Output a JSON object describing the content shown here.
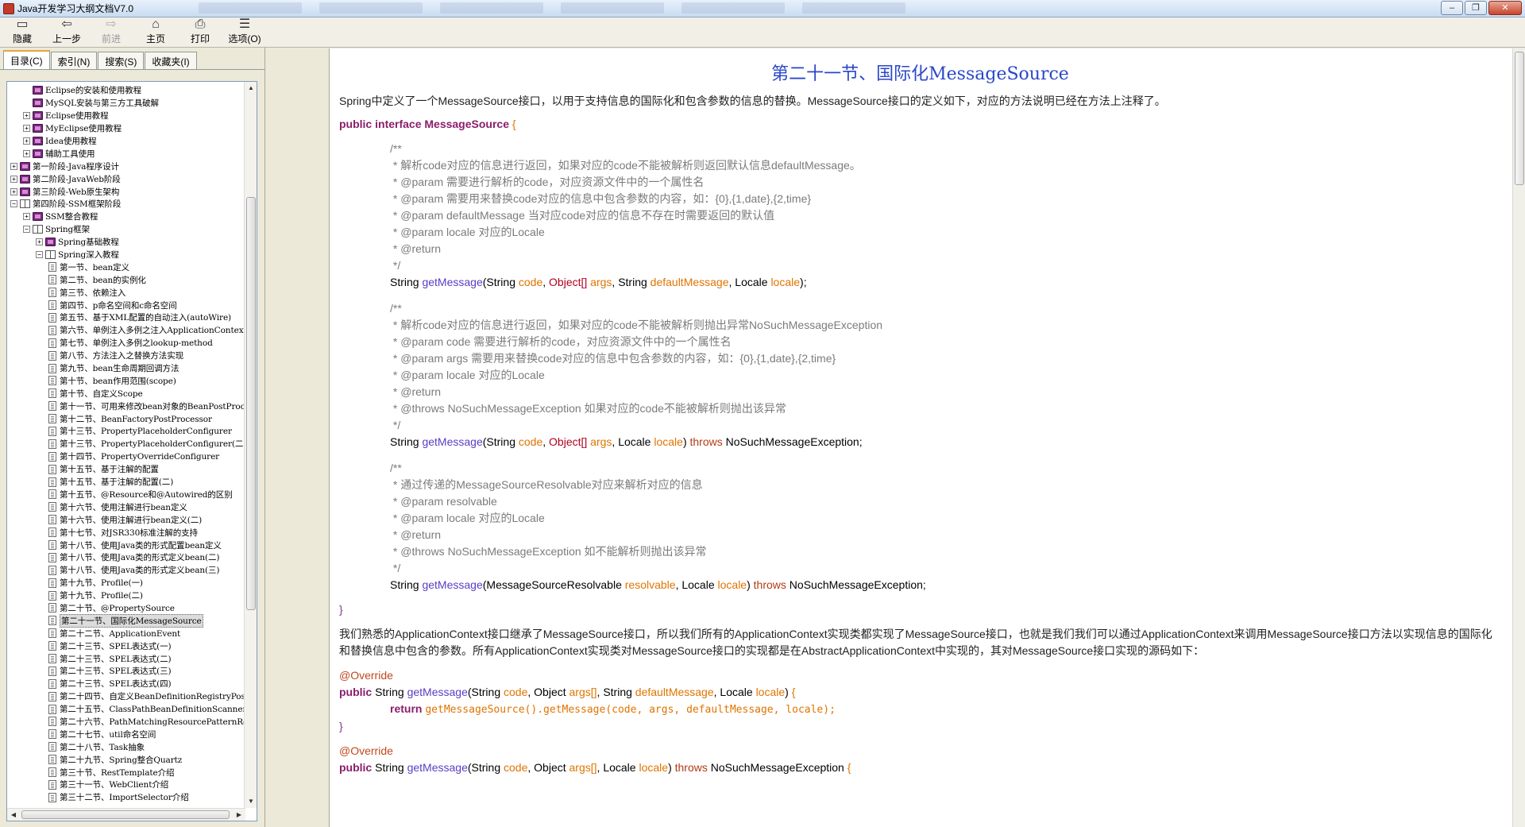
{
  "window": {
    "title": "Java开发学习大纲文档V7.0",
    "buttons": [
      "‒",
      "❐",
      "✕"
    ]
  },
  "toolbar": [
    {
      "label": "隐藏",
      "icon": "hide-icon",
      "disabled": false
    },
    {
      "label": "上一步",
      "icon": "back-arrow-icon",
      "disabled": false
    },
    {
      "label": "前进",
      "icon": "forward-arrow-icon",
      "disabled": true
    },
    {
      "label": "主页",
      "icon": "home-icon",
      "disabled": false
    },
    {
      "label": "打印",
      "icon": "print-icon",
      "disabled": false
    },
    {
      "label": "选项(O)",
      "icon": "options-icon",
      "disabled": false
    }
  ],
  "nav_tabs": [
    "目录(C)",
    "索引(N)",
    "搜索(S)",
    "收藏夹(I)"
  ],
  "tree": [
    {
      "indent": 1,
      "exp": "",
      "icon": "closed",
      "label": "Eclipse的安装和使用教程"
    },
    {
      "indent": 1,
      "exp": "",
      "icon": "closed",
      "label": "MySQL安装与第三方工具破解"
    },
    {
      "indent": 1,
      "exp": "+",
      "icon": "closed",
      "label": "Eclipse使用教程"
    },
    {
      "indent": 1,
      "exp": "+",
      "icon": "closed",
      "label": "MyEclipse使用教程"
    },
    {
      "indent": 1,
      "exp": "+",
      "icon": "closed",
      "label": "Idea使用教程"
    },
    {
      "indent": 1,
      "exp": "+",
      "icon": "closed",
      "label": "辅助工具使用"
    },
    {
      "indent": 0,
      "exp": "+",
      "icon": "closed",
      "label": "第一阶段-Java程序设计"
    },
    {
      "indent": 0,
      "exp": "+",
      "icon": "closed",
      "label": "第二阶段-JavaWeb阶段"
    },
    {
      "indent": 0,
      "exp": "+",
      "icon": "closed",
      "label": "第三阶段-Web原生架构"
    },
    {
      "indent": 0,
      "exp": "−",
      "icon": "open",
      "label": "第四阶段-SSM框架阶段"
    },
    {
      "indent": 1,
      "exp": "+",
      "icon": "closed",
      "label": "SSM整合教程"
    },
    {
      "indent": 1,
      "exp": "−",
      "icon": "open",
      "label": "Spring框架"
    },
    {
      "indent": 2,
      "exp": "+",
      "icon": "closed",
      "label": "Spring基础教程"
    },
    {
      "indent": 2,
      "exp": "−",
      "icon": "open",
      "label": "Spring深入教程"
    },
    {
      "indent": 3,
      "exp": "",
      "icon": "page",
      "label": "第一节、bean定义"
    },
    {
      "indent": 3,
      "exp": "",
      "icon": "page",
      "label": "第二节、bean的实例化"
    },
    {
      "indent": 3,
      "exp": "",
      "icon": "page",
      "label": "第三节、依赖注入"
    },
    {
      "indent": 3,
      "exp": "",
      "icon": "page",
      "label": "第四节、p命名空间和c命名空间"
    },
    {
      "indent": 3,
      "exp": "",
      "icon": "page",
      "label": "第五节、基于XML配置的自动注入(autoWire)"
    },
    {
      "indent": 3,
      "exp": "",
      "icon": "page",
      "label": "第六节、单例注入多例之注入ApplicationContext"
    },
    {
      "indent": 3,
      "exp": "",
      "icon": "page",
      "label": "第七节、单例注入多例之lookup-method"
    },
    {
      "indent": 3,
      "exp": "",
      "icon": "page",
      "label": "第八节、方法注入之替换方法实现"
    },
    {
      "indent": 3,
      "exp": "",
      "icon": "page",
      "label": "第九节、bean生命周期回调方法"
    },
    {
      "indent": 3,
      "exp": "",
      "icon": "page",
      "label": "第十节、bean作用范围(scope)"
    },
    {
      "indent": 3,
      "exp": "",
      "icon": "page",
      "label": "第十节、自定义Scope"
    },
    {
      "indent": 3,
      "exp": "",
      "icon": "page",
      "label": "第十一节、可用来修改bean对象的BeanPostProcess"
    },
    {
      "indent": 3,
      "exp": "",
      "icon": "page",
      "label": "第十二节、BeanFactoryPostProcessor"
    },
    {
      "indent": 3,
      "exp": "",
      "icon": "page",
      "label": "第十三节、PropertyPlaceholderConfigurer"
    },
    {
      "indent": 3,
      "exp": "",
      "icon": "page",
      "label": "第十三节、PropertyPlaceholderConfigurer(二)"
    },
    {
      "indent": 3,
      "exp": "",
      "icon": "page",
      "label": "第十四节、PropertyOverrideConfigurer"
    },
    {
      "indent": 3,
      "exp": "",
      "icon": "page",
      "label": "第十五节、基于注解的配置"
    },
    {
      "indent": 3,
      "exp": "",
      "icon": "page",
      "label": "第十五节、基于注解的配置(二)"
    },
    {
      "indent": 3,
      "exp": "",
      "icon": "page",
      "label": "第十五节、@Resource和@Autowired的区别"
    },
    {
      "indent": 3,
      "exp": "",
      "icon": "page",
      "label": "第十六节、使用注解进行bean定义"
    },
    {
      "indent": 3,
      "exp": "",
      "icon": "page",
      "label": "第十六节、使用注解进行bean定义(二)"
    },
    {
      "indent": 3,
      "exp": "",
      "icon": "page",
      "label": "第十七节、对JSR330标准注解的支持"
    },
    {
      "indent": 3,
      "exp": "",
      "icon": "page",
      "label": "第十八节、使用Java类的形式配置bean定义"
    },
    {
      "indent": 3,
      "exp": "",
      "icon": "page",
      "label": "第十八节、使用Java类的形式定义bean(二)"
    },
    {
      "indent": 3,
      "exp": "",
      "icon": "page",
      "label": "第十八节、使用Java类的形式定义bean(三)"
    },
    {
      "indent": 3,
      "exp": "",
      "icon": "page",
      "label": "第十九节、Profile(一)"
    },
    {
      "indent": 3,
      "exp": "",
      "icon": "page",
      "label": "第十九节、Profile(二)"
    },
    {
      "indent": 3,
      "exp": "",
      "icon": "page",
      "label": "第二十节、@PropertySource"
    },
    {
      "indent": 3,
      "exp": "",
      "icon": "page",
      "label": "第二十一节、国际化MessageSource",
      "selected": true
    },
    {
      "indent": 3,
      "exp": "",
      "icon": "page",
      "label": "第二十二节、ApplicationEvent"
    },
    {
      "indent": 3,
      "exp": "",
      "icon": "page",
      "label": "第二十三节、SPEL表达式(一)"
    },
    {
      "indent": 3,
      "exp": "",
      "icon": "page",
      "label": "第二十三节、SPEL表达式(二)"
    },
    {
      "indent": 3,
      "exp": "",
      "icon": "page",
      "label": "第二十三节、SPEL表达式(三)"
    },
    {
      "indent": 3,
      "exp": "",
      "icon": "page",
      "label": "第二十三节、SPEL表达式(四)"
    },
    {
      "indent": 3,
      "exp": "",
      "icon": "page",
      "label": "第二十四节、自定义BeanDefinitionRegistryPostP"
    },
    {
      "indent": 3,
      "exp": "",
      "icon": "page",
      "label": "第二十五节、ClassPathBeanDefinitionScanner"
    },
    {
      "indent": 3,
      "exp": "",
      "icon": "page",
      "label": "第二十六节、PathMatchingResourcePatternResolv"
    },
    {
      "indent": 3,
      "exp": "",
      "icon": "page",
      "label": "第二十七节、util命名空间"
    },
    {
      "indent": 3,
      "exp": "",
      "icon": "page",
      "label": "第二十八节、Task抽象"
    },
    {
      "indent": 3,
      "exp": "",
      "icon": "page",
      "label": "第二十九节、Spring整合Quartz"
    },
    {
      "indent": 3,
      "exp": "",
      "icon": "page",
      "label": "第三十节、RestTemplate介绍"
    },
    {
      "indent": 3,
      "exp": "",
      "icon": "page",
      "label": "第三十一节、WebClient介绍"
    },
    {
      "indent": 3,
      "exp": "",
      "icon": "page",
      "label": "第三十二节、ImportSelector介绍"
    }
  ],
  "doc": {
    "title": "第二十一节、国际化MessageSource",
    "intro": "Spring中定义了一个MessageSource接口，以用于支持信息的国际化和包含参数的信息的替换。MessageSource接口的定义如下，对应的方法说明已经在方法上注释了。",
    "iface_public": "public",
    "iface_interface": "interface",
    "iface_name": "MessageSource",
    "brace_open": "{",
    "brace_close": "}",
    "c1": [
      "/**",
      " * 解析code对应的信息进行返回，如果对应的code不能被解析则返回默认信息defaultMessage。",
      " * @param 需要进行解析的code，对应资源文件中的一个属性名",
      " * @param 需要用来替换code对应的信息中包含参数的内容，如：{0},{1,date},{2,time}",
      " * @param defaultMessage 当对应code对应的信息不存在时需要返回的默认值",
      " * @param locale 对应的Locale",
      " * @return",
      " */"
    ],
    "c2": [
      "/**",
      " * 解析code对应的信息进行返回，如果对应的code不能被解析则抛出异常NoSuchMessageException",
      " * @param code 需要进行解析的code，对应资源文件中的一个属性名",
      " * @param args 需要用来替换code对应的信息中包含参数的内容，如：{0},{1,date},{2,time}",
      " * @param locale 对应的Locale",
      " * @return",
      " * @throws NoSuchMessageException 如果对应的code不能被解析则抛出该异常",
      " */"
    ],
    "c3": [
      "/**",
      " * 通过传递的MessageSourceResolvable对应来解析对应的信息",
      " * @param resolvable",
      " * @param locale 对应的Locale",
      " * @return",
      " * @throws NoSuchMessageException 如不能解析则抛出该异常",
      " */"
    ],
    "t_string": "String",
    "t_getmessage": "getMessage",
    "t_object": "Object",
    "t_locale": "Locale",
    "t_throws": "throws",
    "t_nsme": "NoSuchMessageException",
    "t_msr": "MessageSourceResolvable",
    "p_code": "code",
    "p_args": "args",
    "p_default": "defaultMessage",
    "p_locale": "locale",
    "p_resolvable": "resolvable",
    "arr": "[]",
    "para2": "我们熟悉的ApplicationContext接口继承了MessageSource接口，所以我们所有的ApplicationContext实现类都实现了MessageSource接口，也就是我们我们可以通过ApplicationContext来调用MessageSource接口方法以实现信息的国际化和替换信息中包含的参数。所有ApplicationContext实现类对MessageSource接口的实现都是在AbstractApplicationContext中实现的，其对MessageSource接口实现的源码如下：",
    "override": "@Override",
    "pub": "public",
    "ret": "return",
    "ret_expr": "getMessageSource().getMessage(code, args, defaultMessage, locale);"
  }
}
